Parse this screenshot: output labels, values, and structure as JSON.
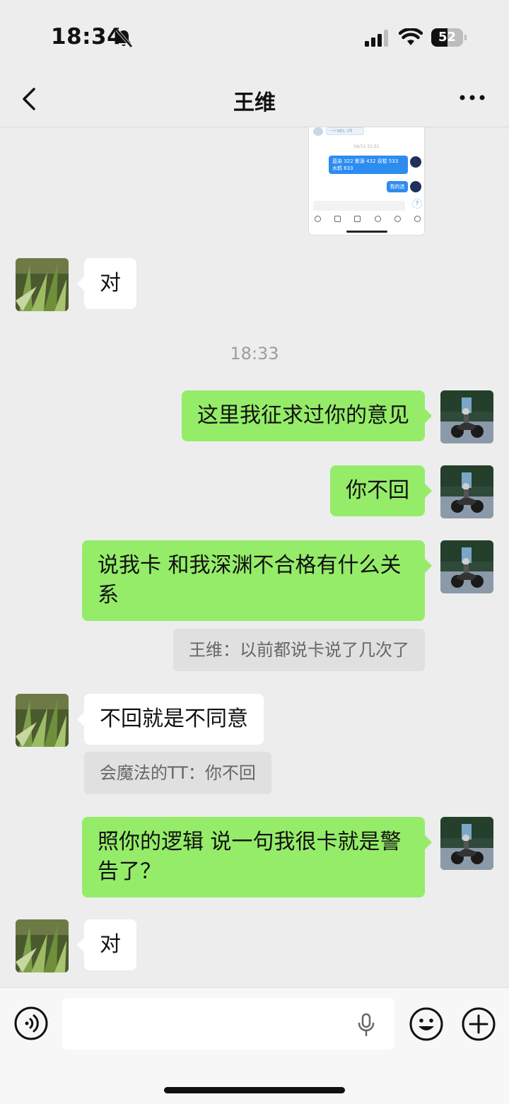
{
  "status_bar": {
    "time": "18:34",
    "battery_level": "52",
    "battery_fraction": 0.52
  },
  "header": {
    "title": "王维"
  },
  "thumbnail": {
    "top_pill": "一个3到3..3号",
    "timestamp": "04/11 21:51",
    "msg1": "蓝染 322 紫源 432 双棍 533 水鹤 633",
    "msg2": "我的选",
    "badge": "?"
  },
  "messages": [
    {
      "side": "in",
      "text": "对"
    },
    {
      "type": "time",
      "text": "18:33"
    },
    {
      "side": "out",
      "text": "这里我征求过你的意见"
    },
    {
      "side": "out",
      "text": "你不回"
    },
    {
      "side": "out",
      "text": "说我卡 和我深渊不合格有什么关系",
      "quote": "王维：以前都说卡说了几次了"
    },
    {
      "side": "in",
      "text": "不回就是不同意",
      "quote": "会魔法的TT：你不回"
    },
    {
      "side": "out",
      "text": "照你的逻辑 说一句我很卡就是警告了？"
    },
    {
      "side": "in",
      "text": "对"
    }
  ],
  "colors": {
    "background": "#ededed",
    "outgoing_bubble": "#95ec69",
    "incoming_bubble": "#ffffff",
    "quote_bg": "#e0e0e0"
  },
  "icons": {
    "status": [
      "bell-off-icon",
      "signal-icon",
      "wifi-icon",
      "battery-icon"
    ],
    "nav": [
      "chevron-left-icon",
      "more-icon"
    ],
    "input": [
      "voice-icon",
      "mic-icon",
      "emoji-icon",
      "plus-icon"
    ]
  }
}
